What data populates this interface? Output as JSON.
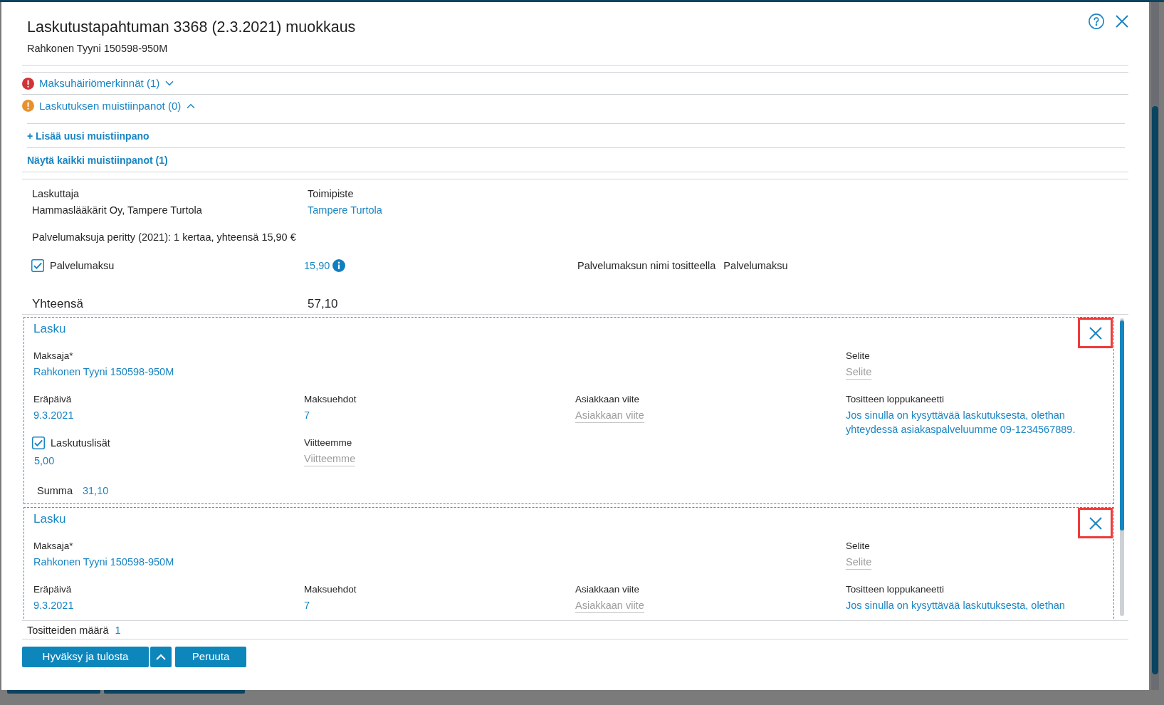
{
  "dialog": {
    "title": "Laskutustapahtuman 3368 (2.3.2021) muokkaus",
    "subtitle": "Rahkonen Tyyni 150598-950M"
  },
  "alerts": [
    {
      "label": "Maksuhäiriömerkinnät (1)",
      "color": "#d13438",
      "expanded": false
    },
    {
      "label": "Laskutuksen muistiinpanot (0)",
      "color": "#e8922e",
      "expanded": true,
      "links": [
        "+ Lisää uusi muistiinpano",
        "Näytä kaikki muistiinpanot (1)"
      ]
    }
  ],
  "billing": {
    "biller": {
      "label": "Laskuttaja",
      "value": "Hammaslääkärit Oy, Tampere Turtola"
    },
    "office": {
      "label": "Toimipiste",
      "value": "Tampere Turtola"
    },
    "fee_summary": "Palvelumaksuja peritty (2021): 1 kertaa, yhteensä 15,90 €",
    "service_fee": {
      "label": "Palvelumaksu",
      "checked": true,
      "amount": "15,90",
      "name_label": "Palvelumaksun nimi tositteella",
      "name_value": "Palvelumaksu"
    },
    "total": {
      "label": "Yhteensä",
      "value": "57,10"
    }
  },
  "invoices": [
    {
      "title": "Lasku",
      "remove_highlighted": true,
      "payer": {
        "label": "Maksaja*",
        "value": "Rahkonen Tyyni 150598-950M"
      },
      "description": {
        "label": "Selite",
        "placeholder": "Selite"
      },
      "due_date": {
        "label": "Eräpäivä",
        "value": "9.3.2021"
      },
      "payment_terms": {
        "label": "Maksuehdot",
        "value": "7"
      },
      "customer_reference": {
        "label": "Asiakkaan viite",
        "placeholder": "Asiakkaan viite"
      },
      "closing_note": {
        "label": "Tositteen loppukaneetti",
        "value": "Jos sinulla on kysyttävää laskutuksesta, olethan yhteydessä asiakaspalveluumme 09-1234567889."
      },
      "extras": {
        "label": "Laskutuslisät",
        "checked": true,
        "value": "5,00"
      },
      "our_reference": {
        "label": "Viitteemme",
        "placeholder": "Viitteemme"
      },
      "sum": {
        "label": "Summa",
        "value": "31,10"
      }
    },
    {
      "title": "Lasku",
      "remove_highlighted": true,
      "payer": {
        "label": "Maksaja*",
        "value": "Rahkonen Tyyni 150598-950M"
      },
      "description": {
        "label": "Selite",
        "placeholder": "Selite"
      },
      "due_date": {
        "label": "Eräpäivä",
        "value": "9.3.2021"
      },
      "payment_terms": {
        "label": "Maksuehdot",
        "value": "7"
      },
      "customer_reference": {
        "label": "Asiakkaan viite",
        "placeholder": "Asiakkaan viite"
      },
      "closing_note": {
        "label": "Tositteen loppukaneetti",
        "value": "Jos sinulla on kysyttävää laskutuksesta, olethan"
      }
    }
  ],
  "footer": {
    "voucher_count": {
      "label": "Tositteiden määrä",
      "value": "1"
    }
  },
  "actions": {
    "primary": {
      "label": "Hyväksy ja tulosta",
      "has_menu": true
    },
    "cancel": {
      "label": "Peruuta"
    }
  }
}
